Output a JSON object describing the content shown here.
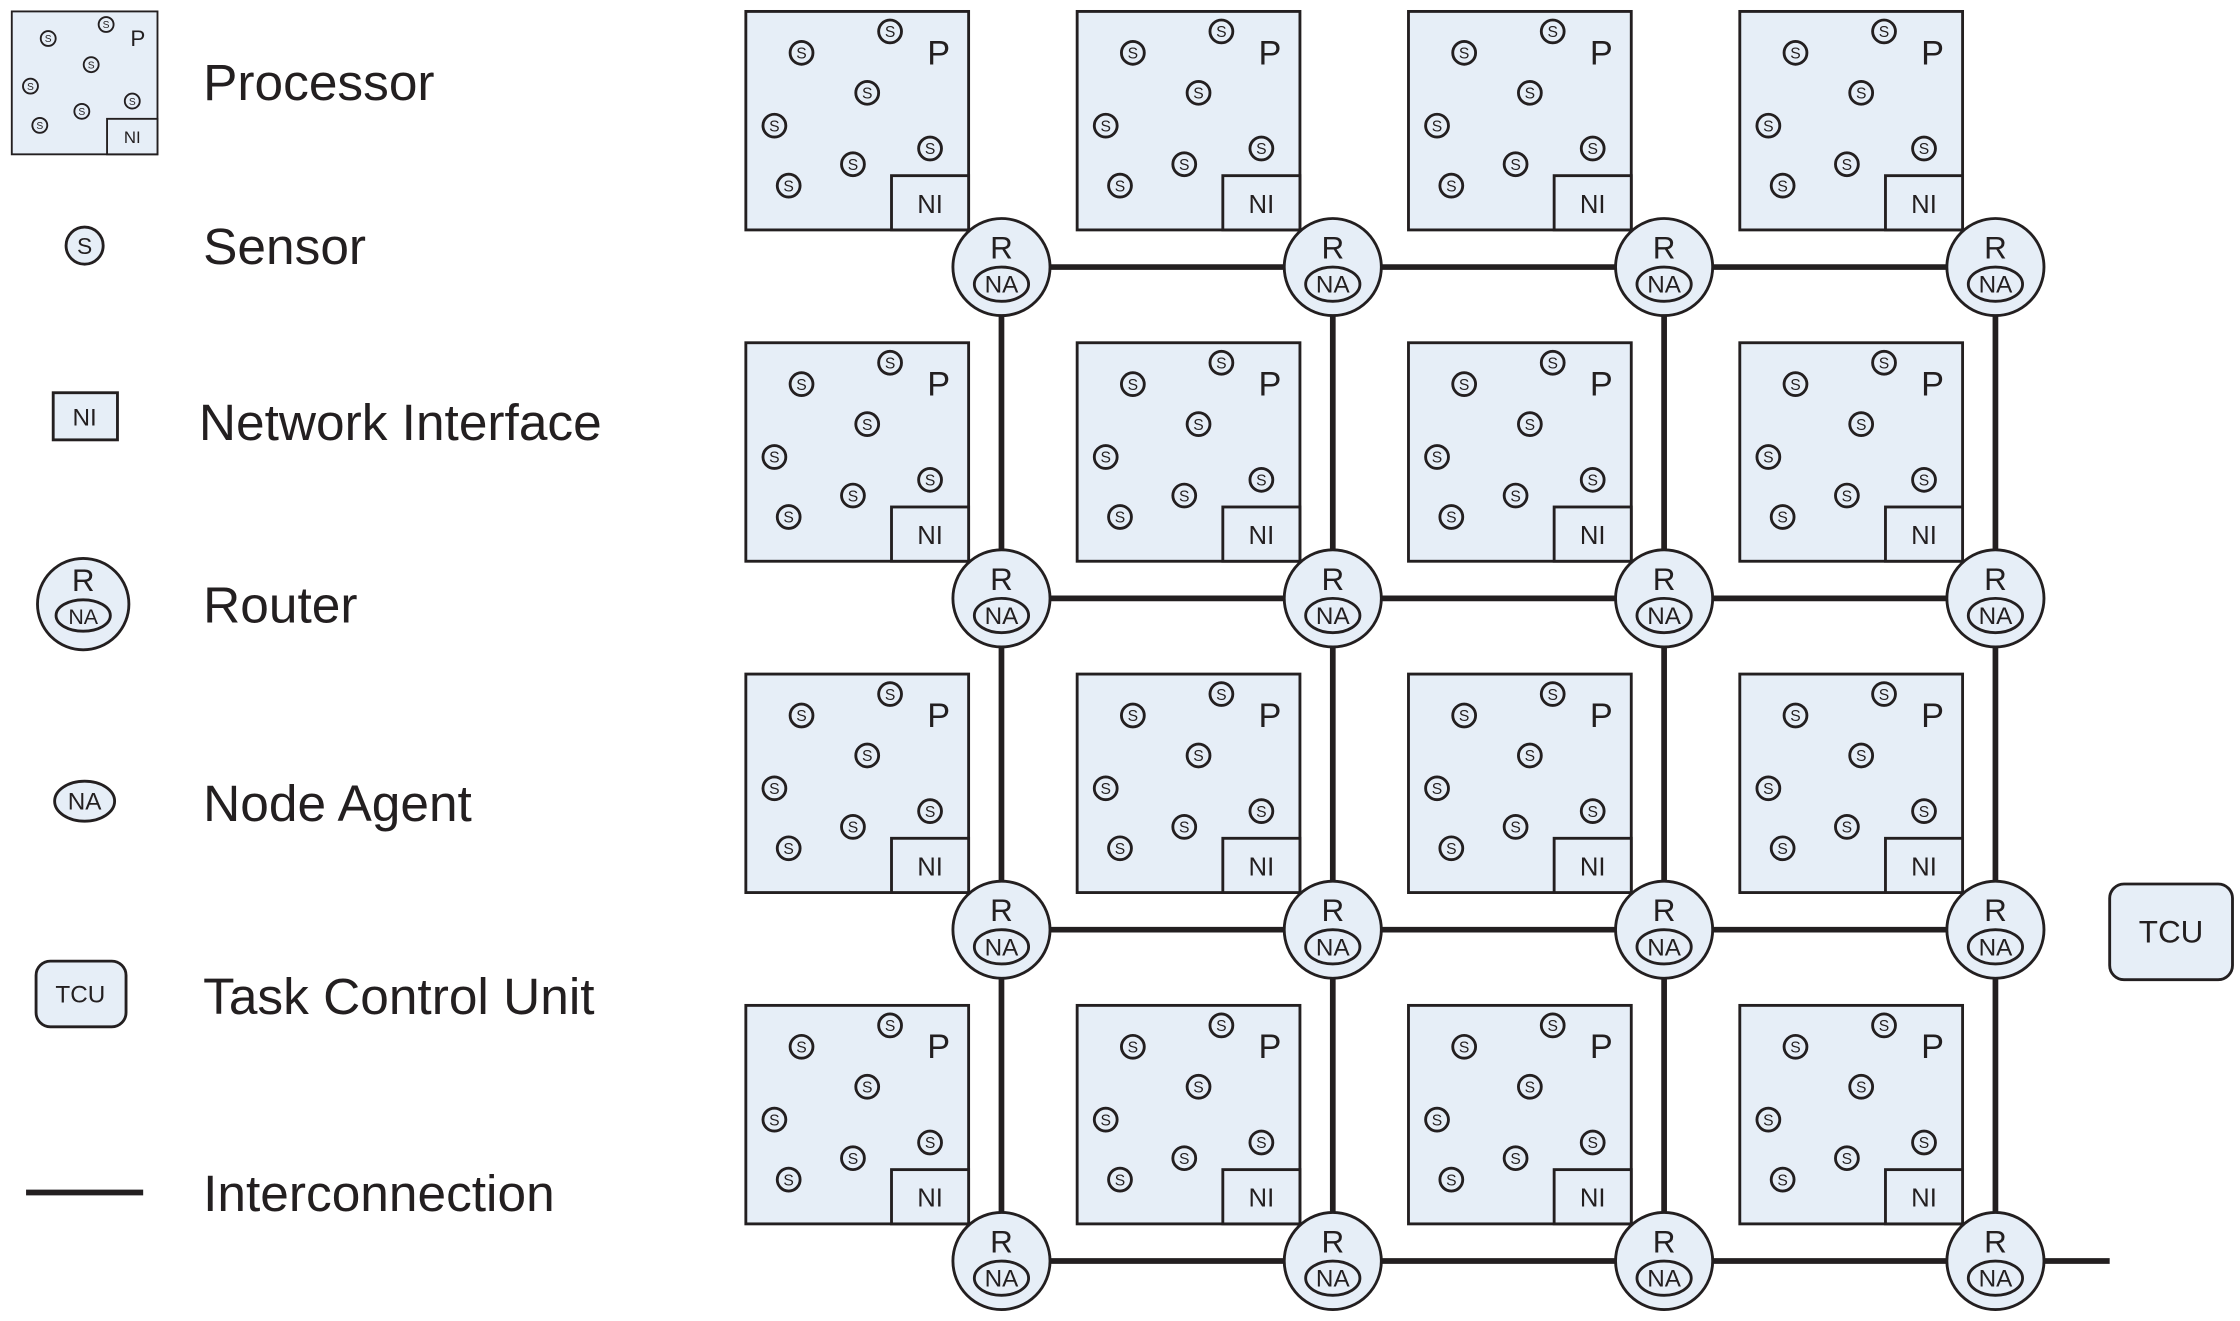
{
  "colors": {
    "fill": "#e6eef7",
    "stroke": "#231f20",
    "background": "#ffffff"
  },
  "symbols": {
    "processor": "P",
    "network_interface": "NI",
    "sensor": "S",
    "router": "R",
    "node_agent": "NA",
    "task_control_unit": "TCU"
  },
  "legend": {
    "processor": "Processor",
    "sensor": "Sensor",
    "network_interface": "Network Interface",
    "router": "Router",
    "node_agent": "Node Agent",
    "task_control_unit": "Task Control Unit",
    "interconnection": "Interconnection"
  },
  "grid": {
    "rows": 4,
    "cols": 4,
    "tcu_attached_row": 3
  }
}
